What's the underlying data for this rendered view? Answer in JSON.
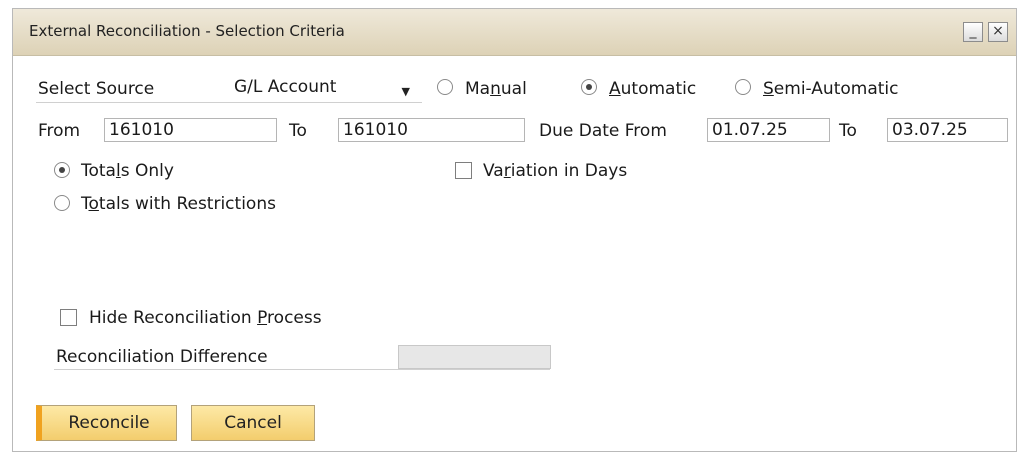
{
  "window": {
    "title": "External Reconciliation - Selection Criteria",
    "minimize_glyph": "_",
    "close_glyph": "×"
  },
  "source": {
    "label": "Select Source",
    "combo_value": "G/L Account",
    "options": [
      {
        "text_pre": "Ma",
        "underline": "n",
        "text_post": "ual",
        "selected": false
      },
      {
        "text_pre": "",
        "underline": "A",
        "text_post": "utomatic",
        "selected": true
      },
      {
        "text_pre": "",
        "underline": "S",
        "text_post": "emi-Automatic",
        "selected": false
      }
    ]
  },
  "range": {
    "from_label": "From",
    "from_value": "161010",
    "to_label": "To",
    "to_value": "161010",
    "due_label": "Due Date From",
    "due_from_value": "01.07.25",
    "due_to_label": "To",
    "due_to_value": "03.07.25"
  },
  "mode": {
    "totals_only": {
      "pre": "Tota",
      "u": "l",
      "post": "s Only",
      "selected": true
    },
    "totals_restrictions": {
      "pre": "T",
      "u": "o",
      "post": "tals with Restrictions",
      "selected": false
    }
  },
  "variation": {
    "pre": "Va",
    "u": "r",
    "post": "iation in Days",
    "checked": false
  },
  "hide_process": {
    "pre": "Hide Reconciliation ",
    "u": "P",
    "post": "rocess",
    "checked": false
  },
  "difference": {
    "label": "Reconciliation Difference",
    "value": ""
  },
  "buttons": {
    "reconcile": "Reconcile",
    "cancel": "Cancel"
  },
  "colors": {
    "title_bar": "#ddd2b6",
    "button": "#f3cd6d",
    "button_accent": "#f0a21f"
  }
}
